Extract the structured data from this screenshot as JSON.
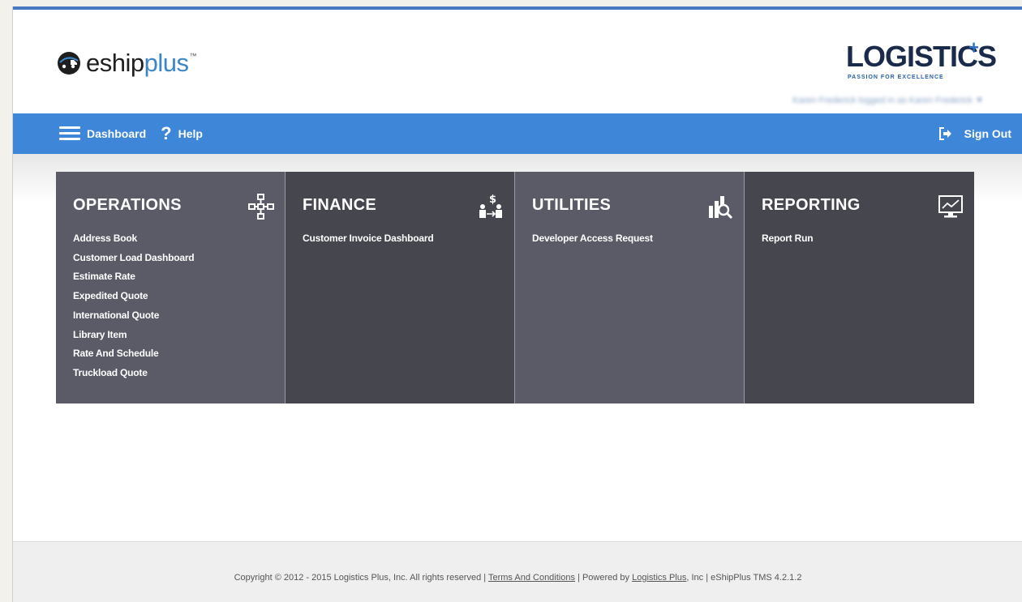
{
  "header": {
    "brand": {
      "name_dark": "eship",
      "name_light": "plus",
      "trademark": "™"
    },
    "partner_logo": {
      "text": "LOGISTICS",
      "plus": "+",
      "tagline": "PASSION FOR EXCELLENCE"
    },
    "logged_in_text": "Karen Frederick logged in as Karen Frederick ▼"
  },
  "navbar": {
    "dashboard_label": "Dashboard",
    "help_label": "Help",
    "sign_out_label": "Sign Out"
  },
  "tiles": [
    {
      "title": "OPERATIONS",
      "icon": "sitemap-icon",
      "color": "#5a5b66",
      "links": [
        "Address Book",
        "Customer Load Dashboard",
        "Estimate Rate",
        "Expedited Quote",
        "International Quote",
        "Library Item",
        "Rate And Schedule",
        "Truckload Quote"
      ]
    },
    {
      "title": "FINANCE",
      "icon": "finance-icon",
      "color": "#46464f",
      "links": [
        "Customer Invoice Dashboard"
      ]
    },
    {
      "title": "UTILITIES",
      "icon": "utilities-icon",
      "color": "#5a5b66",
      "links": [
        "Developer Access Request"
      ]
    },
    {
      "title": "REPORTING",
      "icon": "monitor-chart-icon",
      "color": "#46464f",
      "links": [
        "Report Run"
      ]
    }
  ],
  "footer": {
    "copyright": "Copyright © 2012 - 2015 Logistics Plus, Inc. All rights reserved | ",
    "terms_link": "Terms And Conditions",
    "powered_prefix": " | Powered by ",
    "powered_link": "Logistics Plus",
    "suffix": ", Inc | eShipPlus TMS 4.2.1.2"
  },
  "colors": {
    "navbar": "#3d86d8",
    "brand_blue": "#3a86c9",
    "tile_light": "#5a5b66",
    "tile_dark": "#46464f"
  }
}
